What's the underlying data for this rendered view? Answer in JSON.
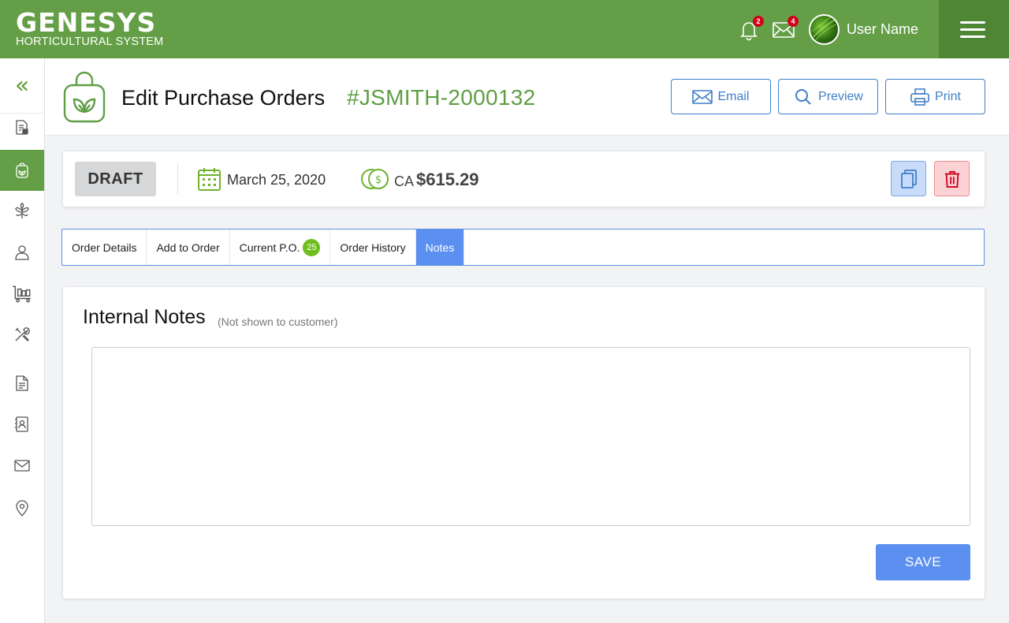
{
  "app": {
    "logo_main": "GENESYS",
    "logo_sub": "HORTICULTURAL SYSTEM",
    "brand_color": "#649f47"
  },
  "topbar": {
    "notifications_count": "2",
    "messages_count": "4",
    "user_name": "User Name"
  },
  "header": {
    "title": "Edit Purchase Orders",
    "po_number": "#JSMITH-2000132",
    "buttons": {
      "email": "Email",
      "preview": "Preview",
      "print": "Print"
    }
  },
  "status": {
    "state": "DRAFT",
    "date": "March 25, 2020",
    "currency": "CA",
    "amount": "$615.29"
  },
  "tabs": [
    {
      "label": "Order Details",
      "active": false
    },
    {
      "label": "Add to Order",
      "active": false
    },
    {
      "label": "Current P.O.",
      "count": "25",
      "active": false
    },
    {
      "label": "Order History",
      "active": false
    },
    {
      "label": "Notes",
      "active": true
    }
  ],
  "notes": {
    "title": "Internal Notes",
    "subtitle": "(Not shown to customer)",
    "value": "",
    "save_label": "SAVE"
  },
  "sidebar": {
    "collapse_icon": "double-chevron-left-icon",
    "items": [
      {
        "icon": "document-lock-icon",
        "active": false
      },
      {
        "icon": "shopping-bag-leaf-icon",
        "active": true
      },
      {
        "icon": "plant-icon",
        "active": false
      },
      {
        "icon": "user-icon",
        "active": false
      },
      {
        "icon": "cart-icon",
        "active": false
      },
      {
        "icon": "tools-icon",
        "active": false
      },
      {
        "icon": "document-icon",
        "active": false
      },
      {
        "icon": "contact-book-icon",
        "active": false
      },
      {
        "icon": "mail-icon",
        "active": false
      },
      {
        "icon": "location-pin-icon",
        "active": false
      }
    ]
  }
}
